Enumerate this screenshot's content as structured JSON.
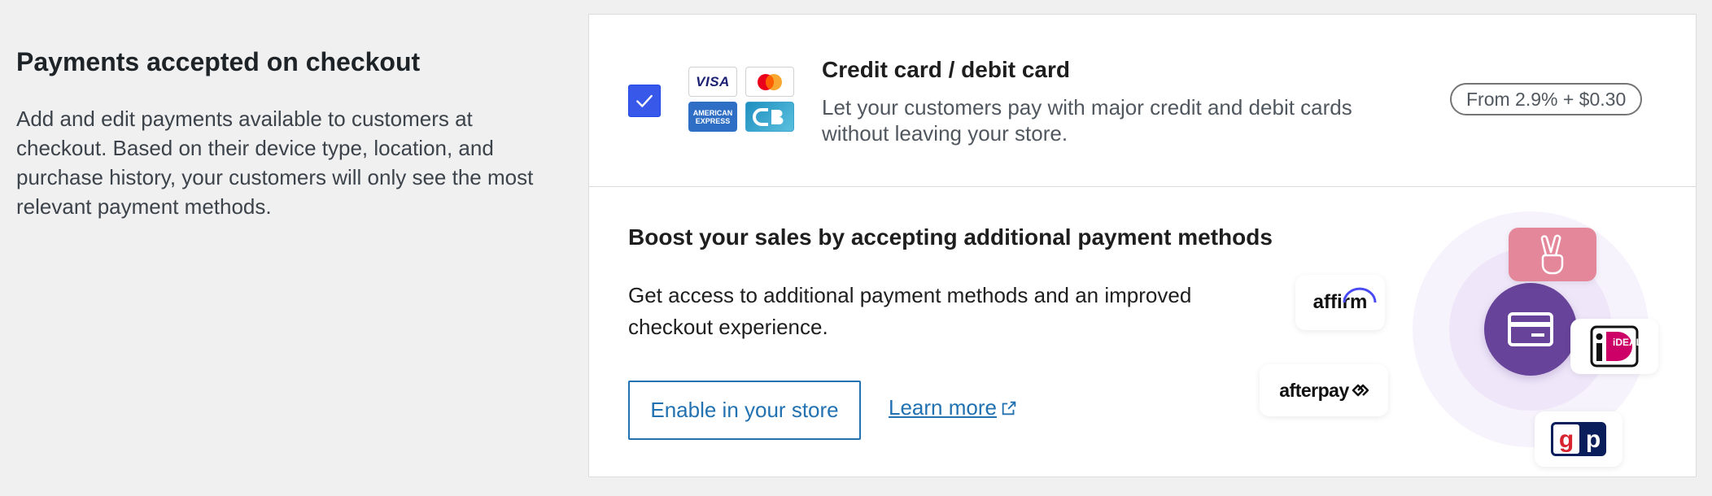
{
  "section": {
    "title": "Payments accepted on checkout",
    "description": "Add and edit payments available to customers at checkout. Based on their device type, location, and purchase history, your customers will only see the most relevant payment methods."
  },
  "credit_card": {
    "checked": true,
    "title": "Credit card / debit card",
    "description": "Let your customers pay with major credit and debit cards without leaving your store.",
    "fee": "From 2.9% + $0.30",
    "logos": {
      "visa": "VISA",
      "amex_line1": "AMERICAN",
      "amex_line2": "EXPRESS"
    }
  },
  "promo": {
    "title": "Boost your sales by accepting additional payment methods",
    "description": "Get access to additional payment methods and an improved checkout experience.",
    "enable_button": "Enable in your store",
    "learn_more": "Learn more"
  },
  "payment_method_logos": {
    "affirm": "affirm",
    "afterpay": "afterpay",
    "ideal": "iDEAL"
  },
  "colors": {
    "accent": "#2271b1",
    "checkbox": "#3858e9",
    "center_circle": "#674399",
    "klarna_tile": "#e5879a"
  }
}
